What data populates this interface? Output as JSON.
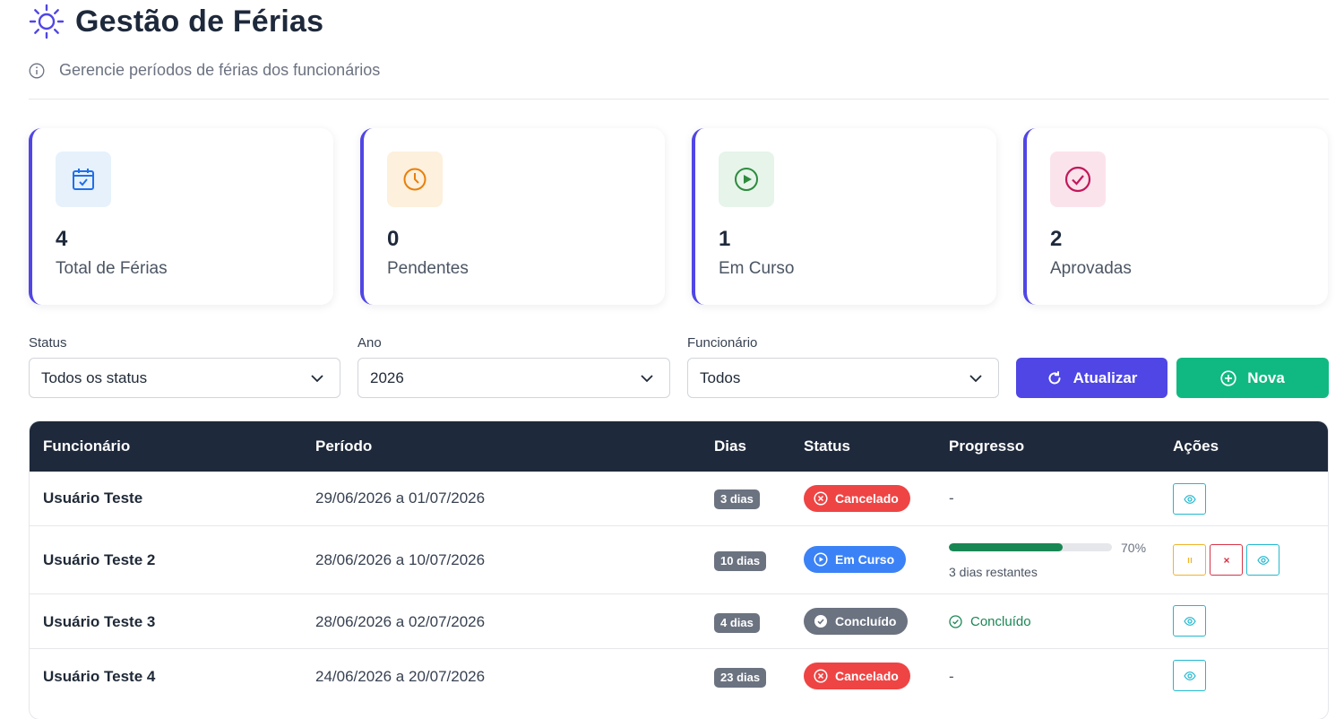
{
  "header": {
    "title": "Gestão de Férias",
    "subtitle": "Gerencie períodos de férias dos funcionários"
  },
  "cards": [
    {
      "value": "4",
      "label": "Total de Férias",
      "icon": "calendar-check-icon",
      "icon_color": "#1f6feb",
      "icon_bg": "#e6f1fb"
    },
    {
      "value": "0",
      "label": "Pendentes",
      "icon": "clock-icon",
      "icon_color": "#e97f0b",
      "icon_bg": "#fdf0dc"
    },
    {
      "value": "1",
      "label": "Em Curso",
      "icon": "play-circle-icon",
      "icon_color": "#2e8b3e",
      "icon_bg": "#e6f4ea"
    },
    {
      "value": "2",
      "label": "Aprovadas",
      "icon": "check-circle-icon",
      "icon_color": "#c2185b",
      "icon_bg": "#fbe3ec"
    }
  ],
  "filters": {
    "status_label": "Status",
    "status_value": "Todos os status",
    "year_label": "Ano",
    "year_value": "2026",
    "employee_label": "Funcionário",
    "employee_value": "Todos"
  },
  "buttons": {
    "refresh": "Atualizar",
    "new": "Nova",
    "refresh_color": "#4f46e5",
    "new_color": "#10b981"
  },
  "table": {
    "headers": [
      "Funcionário",
      "Período",
      "Dias",
      "Status",
      "Progresso",
      "Ações"
    ],
    "rows": [
      {
        "name": "Usuário Teste",
        "period": "29/06/2026 a 01/07/2026",
        "days": "3 dias",
        "status": "Cancelado",
        "progress": "-"
      },
      {
        "name": "Usuário Teste 2",
        "period": "28/06/2026 a 10/07/2026",
        "days": "10 dias",
        "status": "Em Curso",
        "progress_percent": 70,
        "progress_label": "70%",
        "remaining": "3 dias restantes"
      },
      {
        "name": "Usuário Teste 3",
        "period": "28/06/2026 a 02/07/2026",
        "days": "4 dias",
        "status": "Concluído",
        "progress": "Concluído"
      },
      {
        "name": "Usuário Teste 4",
        "period": "24/06/2026 a 20/07/2026",
        "days": "23 dias",
        "status": "Cancelado",
        "progress": "-"
      }
    ]
  },
  "colors": {
    "accent": "#5046e5",
    "header_bg": "#1e293b",
    "cancelado": "#ef4444",
    "em_curso": "#3b82f6",
    "concluido": "#6b7280",
    "progress_fill": "#198754"
  }
}
